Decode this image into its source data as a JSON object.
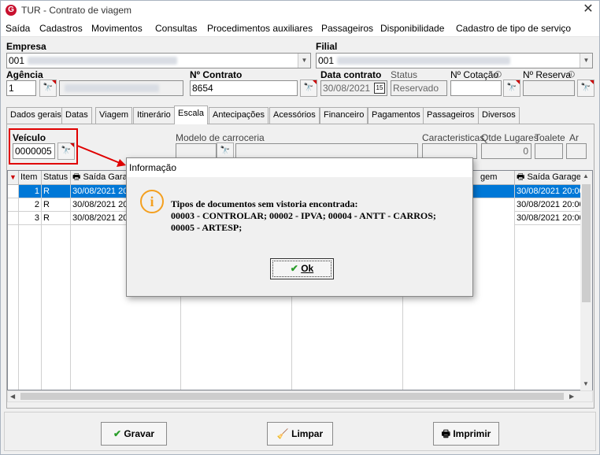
{
  "window": {
    "title": "TUR - Contrato de viagem",
    "logo_letter": "G",
    "minimize": "—",
    "close": "✕"
  },
  "menu": [
    "Saída",
    "Cadastros",
    "Movimentos",
    "Consultas",
    "Procedimentos auxiliares",
    "Passageiros",
    "Disponibilidade",
    "Cadastro de tipo de serviço"
  ],
  "header": {
    "empresa_label": "Empresa",
    "empresa_value": "001",
    "filial_label": "Filial",
    "filial_value": "001",
    "agencia_label": "Agência",
    "agencia_value": "1",
    "contrato_label": "Nº Contrato",
    "contrato_value": "8654",
    "data_contrato_label": "Data contrato",
    "data_contrato_value": "30/08/2021",
    "calendar_icon_text": "15",
    "status_label": "Status",
    "status_value": "Reservado",
    "cotacao_label": "Nº Cotação",
    "reserva_label": "Nº Reserva"
  },
  "tabs": [
    "Dados gerais",
    "Datas",
    "Viagem",
    "Itinerário",
    "Escala",
    "Antecipações",
    "Acessórios",
    "Financeiro",
    "Pagamentos",
    "Passageiros",
    "Diversos"
  ],
  "active_tab": "Escala",
  "escala": {
    "veiculo_label": "Veículo",
    "veiculo_value": "0000005",
    "modelo_label": "Modelo de carroceria",
    "caracteristicas_label": "Caracteristicas",
    "qtde_lugares_label": "Qtde Lugares",
    "qtde_lugares_value": "0",
    "toalete_label": "Toalete",
    "ar_label": "Ar"
  },
  "grid": {
    "columns": [
      "Item",
      "Status",
      "Saída Garagem",
      "Saída Garagem"
    ],
    "partial_header": "gem",
    "rows": [
      {
        "item": "1",
        "status": "R",
        "saida": "30/08/2021 20:00",
        "saida2": "30/08/2021 20:00"
      },
      {
        "item": "2",
        "status": "R",
        "saida": "30/08/2021 20:00",
        "saida2": "30/08/2021 20:00"
      },
      {
        "item": "3",
        "status": "R",
        "saida": "30/08/2021 20:00",
        "saida2": "30/08/2021 20:00"
      }
    ]
  },
  "buttons": {
    "gravar": "Gravar",
    "limpar": "Limpar",
    "imprimir": "Imprimir"
  },
  "dialog": {
    "title": "Informação",
    "line1": "Tipos de documentos sem vistoria encontrada:",
    "line2": "00003 - CONTROLAR; 00002 - IPVA; 00004 - ANTT - CARROS;",
    "line3": "00005 - ARTESP;",
    "ok_label": "Ok",
    "icon": "info-icon"
  },
  "colors": {
    "selection": "#0078d7",
    "annotation_red": "#e00000",
    "warning_orange": "#f4a020"
  }
}
